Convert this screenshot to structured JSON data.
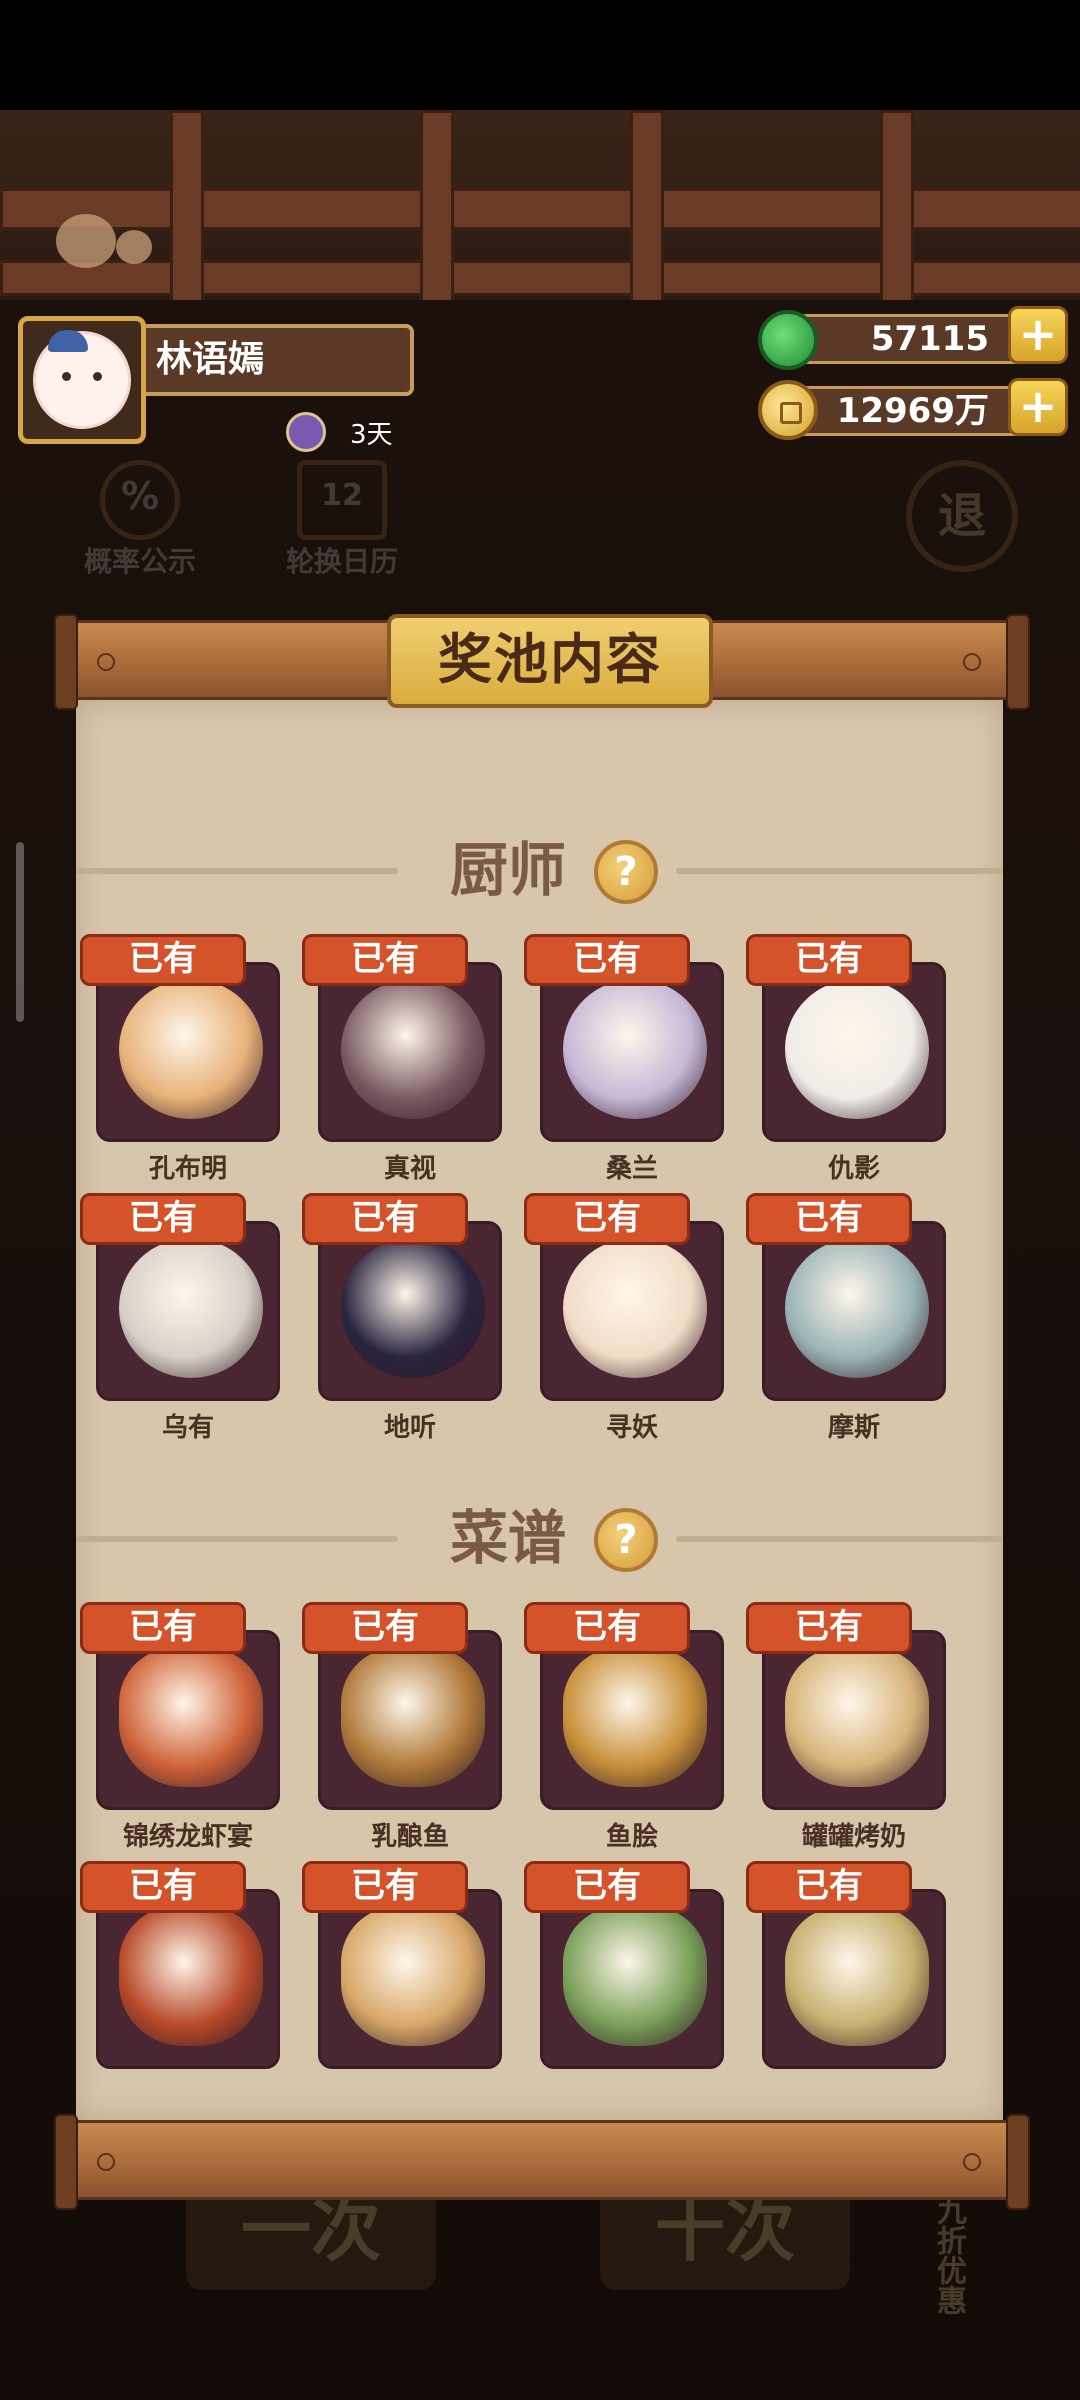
{
  "player": {
    "name": "林语嫣",
    "days_label": "3天"
  },
  "currencies": {
    "jade": "57115",
    "coins": "12969万",
    "plus_label": "+"
  },
  "background": {
    "probability_label": "概率公示",
    "probability_icon_text": "%",
    "calendar_label": "轮换日历",
    "calendar_icon_text": "12",
    "exit_label": "退",
    "draw_one_label": "一次",
    "draw_ten_label": "十次",
    "discount_label": "九折优惠"
  },
  "panel": {
    "title": "奖池内容"
  },
  "sections": {
    "chefs": {
      "title": "厨师",
      "help_label": "?",
      "items": [
        {
          "badge": "已有",
          "name": "孔布明",
          "flames": "🔥🔥🔥🔥🔥",
          "color": "#e7b27a"
        },
        {
          "badge": "已有",
          "name": "真视",
          "flames": "🔥🔥🔥🔥",
          "color": "#7a5a62"
        },
        {
          "badge": "已有",
          "name": "桑兰",
          "flames": "🔥🔥🔥🔥",
          "color": "#c7b8d8"
        },
        {
          "badge": "已有",
          "name": "仇影",
          "flames": "🔥🔥🔥🔥",
          "color": "#f0ece8"
        },
        {
          "badge": "已有",
          "name": "乌有",
          "flames": "🔥🔥🔥",
          "color": "#d8d0c8"
        },
        {
          "badge": "已有",
          "name": "地听",
          "flames": "🔥🔥",
          "color": "#2a2440"
        },
        {
          "badge": "已有",
          "name": "寻妖",
          "flames": "🔥",
          "color": "#f2dcc8"
        },
        {
          "badge": "已有",
          "name": "摩斯",
          "flames": "🔥🔥🔥🔥🔥",
          "color": "#9ab4b8"
        }
      ]
    },
    "recipes": {
      "title": "菜谱",
      "help_label": "?",
      "items": [
        {
          "badge": "已有",
          "name": "锦绣龙虾宴",
          "flames": "🔥🔥🔥🔥🔥",
          "color": "#d0643a"
        },
        {
          "badge": "已有",
          "name": "乳酿鱼",
          "flames": "🔥🔥🔥🔥",
          "color": "#b07a3a"
        },
        {
          "badge": "已有",
          "name": "鱼脍",
          "flames": "🔥🔥🔥🔥",
          "color": "#c8903a"
        },
        {
          "badge": "已有",
          "name": "罐罐烤奶",
          "flames": "🔥🔥🔥",
          "color": "#d8b47a"
        },
        {
          "badge": "已有",
          "name": "",
          "flames": "🔥🔥",
          "color": "#b84a2a"
        },
        {
          "badge": "已有",
          "name": "",
          "flames": "🔥🔥",
          "color": "#d8a86a"
        },
        {
          "badge": "已有",
          "name": "",
          "flames": "🔥",
          "color": "#7aa05a"
        },
        {
          "badge": "已有",
          "name": "",
          "flames": "🔥",
          "color": "#c8b070"
        }
      ]
    }
  }
}
